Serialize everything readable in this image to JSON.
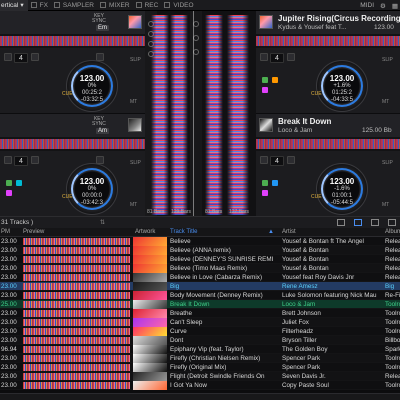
{
  "topbar": {
    "layout": "ertical",
    "tabs": [
      "FX",
      "SAMPLER",
      "MIXER",
      "REC",
      "VIDEO"
    ],
    "right": [
      "MIDI"
    ]
  },
  "decks": {
    "d1": {
      "num": "4",
      "bpm": "123.00",
      "pct": "0%",
      "t1": "00:25:2",
      "t2": "-03:32:5",
      "key": "Em",
      "cue": "CUE",
      "slip": "SLIP",
      "mt": "MT"
    },
    "d2": {
      "title": "Jupiter Rising(Circus Recordings)",
      "artist": "Kydus & Yousef feat T...",
      "bpm": "123.00",
      "num": "4",
      "jog_bpm": "123.00",
      "pct": "+1.6%",
      "t1": "01:25:2",
      "t2": "-04:33:5",
      "cue": "CUE",
      "slip": "SLIP",
      "mt": "MT"
    },
    "d3": {
      "num": "4",
      "bpm": "123.00",
      "pct": "0%",
      "t1": "00:00:0",
      "t2": "-03:42:3",
      "key": "Am",
      "cue": "CUE",
      "slip": "SLIP",
      "mt": "MT"
    },
    "d4": {
      "title": "Break It Down",
      "artist": "Loco & Jam",
      "bpm": "125.00 Bb",
      "num": "4",
      "jog_bpm": "123.00",
      "pct": "-1.6%",
      "t1": "01:00:1",
      "t2": "-05:44:5",
      "cue": "CUE",
      "slip": "SLIP",
      "mt": "MT"
    },
    "keysync": "KEY\nSYNC"
  },
  "center": {
    "labels": [
      "81 Bars",
      "129 Bars",
      "81 Bars",
      "127 Bars"
    ]
  },
  "library": {
    "tracks_label": "31 Tracks )",
    "headers": {
      "bpm": "PM",
      "preview": "Preview",
      "artwork": "Artwork",
      "title": "Track Title",
      "artist": "Artist",
      "album": "Album"
    },
    "rows": [
      {
        "bpm": "23.00",
        "title": "Believe",
        "artist": "Yousef & Bontan ft The Angel",
        "album": "Relea",
        "state": ""
      },
      {
        "bpm": "23.00",
        "title": "Believe (ANNA remix)",
        "artist": "Yousef & Bontan",
        "album": "Relea",
        "state": ""
      },
      {
        "bpm": "23.00",
        "title": "Believe (DENNEY'S SUNRISE REMI",
        "artist": "Yousef & Bontan",
        "album": "Relea",
        "state": ""
      },
      {
        "bpm": "23.00",
        "title": "Believe (Timo Maas Remix)",
        "artist": "Yousef & Bontan",
        "album": "Relea",
        "state": ""
      },
      {
        "bpm": "23.00",
        "title": "Believe in Love (Cabarza Remix)",
        "artist": "Yousef feat Roy Davis Jnr",
        "album": "Relea",
        "state": ""
      },
      {
        "bpm": "23.00",
        "title": "Big",
        "artist": "Rene Amesz",
        "album": "Big",
        "state": "sel"
      },
      {
        "bpm": "23.00",
        "title": "Body Movement (Denney Remix)",
        "artist": "Luke Solomon featuring Nick Mau",
        "album": "Re-Fix",
        "state": ""
      },
      {
        "bpm": "25.00",
        "title": "Break It Down",
        "artist": "Loco & Jam",
        "album": "Toolro",
        "state": "hl"
      },
      {
        "bpm": "23.00",
        "title": "Breathe",
        "artist": "Brett Johnson",
        "album": "Toolro",
        "state": ""
      },
      {
        "bpm": "23.00",
        "title": "Can't Sleep",
        "artist": "Juliet Fox",
        "album": "Toolro",
        "state": ""
      },
      {
        "bpm": "23.00",
        "title": "Curve",
        "artist": "Filterheadz",
        "album": "Toolro",
        "state": ""
      },
      {
        "bpm": "23.00",
        "title": "Dont",
        "artist": "Bryson Tiller",
        "album": "Billbo",
        "state": ""
      },
      {
        "bpm": "96.94",
        "title": "Epiphany Vip (feat. Taylor)",
        "artist": "The Golden Boy",
        "album": "Spark",
        "state": ""
      },
      {
        "bpm": "23.00",
        "title": "Firefly (Christian Nielsen Remix)",
        "artist": "Spencer Park",
        "album": "Toolro",
        "state": ""
      },
      {
        "bpm": "23.00",
        "title": "Firefly (Original Mix)",
        "artist": "Spencer Park",
        "album": "Toolro",
        "state": ""
      },
      {
        "bpm": "23.00",
        "title": "Flight (Detroit Swindle Friends On",
        "artist": "Seven Davis Jr.",
        "album": "Relea",
        "state": ""
      },
      {
        "bpm": "23.00",
        "title": "I Got Ya Now",
        "artist": "Copy Paste Soul",
        "album": "Toolro",
        "state": ""
      }
    ]
  },
  "colors": {
    "accent": "#4a8ef0",
    "selected_row": "#233b63",
    "loaded_track": "#3fd28a",
    "cue": "#e2b340"
  }
}
